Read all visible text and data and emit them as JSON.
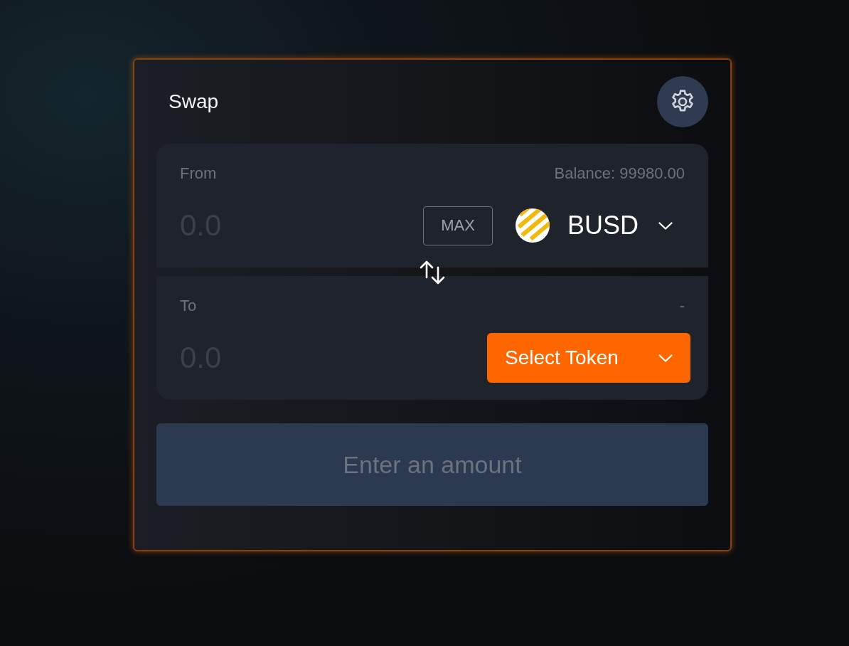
{
  "card": {
    "title": "Swap"
  },
  "panels": [
    {
      "label": "From",
      "info": "Balance: 99980.00",
      "amount": {
        "placeholder": "0.0"
      },
      "max_button": "MAX",
      "token": {
        "kind": "selected",
        "symbol": "BUSD"
      }
    },
    {
      "label": "To",
      "info": "-",
      "amount": {
        "placeholder": "0.0"
      },
      "token": {
        "kind": "select",
        "label": "Select Token"
      }
    }
  ],
  "submit": {
    "label": "Enter an amount",
    "disabled": true
  }
}
